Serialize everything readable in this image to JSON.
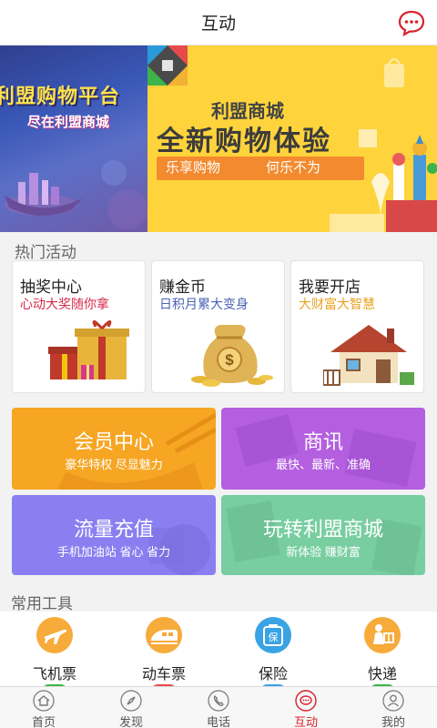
{
  "header": {
    "title": "互动",
    "message_icon": "chat-bubble-icon"
  },
  "banner": {
    "left": {
      "line1": "利盟购物平台",
      "line2": "尽在利盟商城"
    },
    "right": {
      "line1": "利盟商城",
      "line2": "全新购物体验",
      "pill_left": "乐享购物",
      "pill_right": "何乐不为"
    }
  },
  "hot": {
    "title": "热门活动",
    "cards": [
      {
        "title": "抽奖中心",
        "subtitle": "心动大奖随你拿",
        "color": "#d62b4b",
        "icon": "gift-boxes-icon"
      },
      {
        "title": "赚金币",
        "subtitle": "日积月累大变身",
        "color": "#4a63b6",
        "icon": "money-bag-icon"
      },
      {
        "title": "我要开店",
        "subtitle": "大财富大智慧",
        "color": "#e8a321",
        "icon": "house-icon"
      }
    ]
  },
  "tiles": [
    {
      "title": "会员中心",
      "subtitle": "豪华特权  尽显魅力",
      "color": "#f6a623"
    },
    {
      "title": "商讯",
      "subtitle": "最快、最新、准确",
      "color": "#b45fe0"
    },
    {
      "title": "流量充值",
      "subtitle": "手机加油站 省心 省力",
      "color": "#8a7ff0"
    },
    {
      "title": "玩转利盟商城",
      "subtitle": "新体验 赚财富",
      "color": "#78cea0"
    }
  ],
  "tools": {
    "title": "常用工具",
    "items": [
      {
        "label": "飞机票",
        "icon": "airplane-icon",
        "color": "#f6ab3a"
      },
      {
        "label": "动车票",
        "icon": "train-icon",
        "color": "#f6ab3a"
      },
      {
        "label": "保险",
        "icon": "insurance-icon",
        "color": "#3aa3e3"
      },
      {
        "label": "快递",
        "icon": "courier-icon",
        "color": "#f6ab3a"
      }
    ]
  },
  "tabbar": {
    "items": [
      {
        "label": "首页",
        "icon": "home-icon"
      },
      {
        "label": "发现",
        "icon": "compass-icon"
      },
      {
        "label": "电话",
        "icon": "phone-icon"
      },
      {
        "label": "互动",
        "icon": "chat-icon",
        "active": true
      },
      {
        "label": "我的",
        "icon": "user-icon"
      }
    ]
  }
}
